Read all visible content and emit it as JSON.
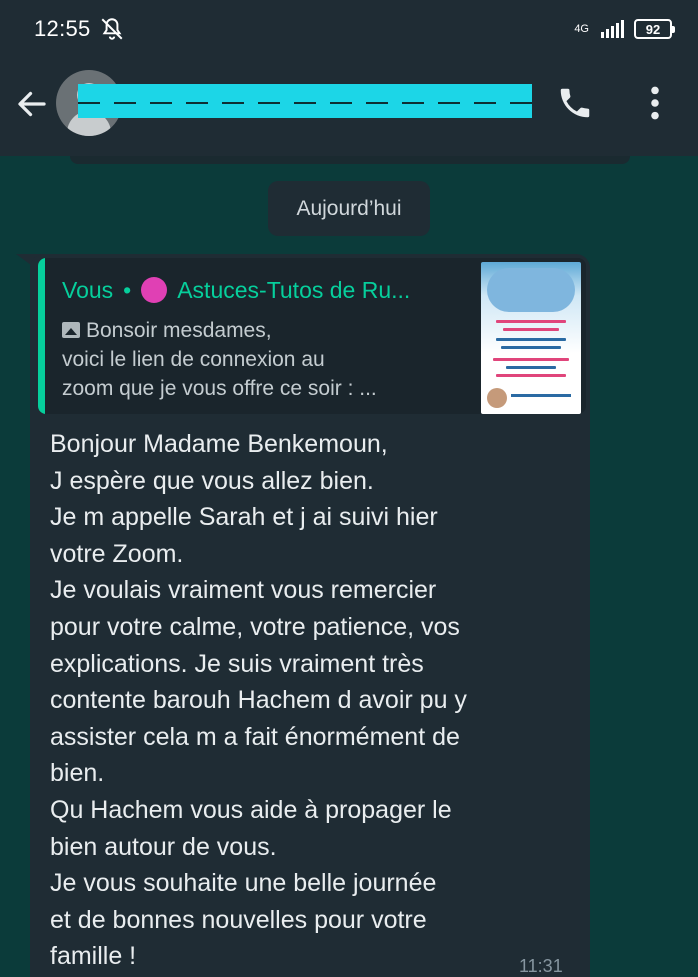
{
  "status_bar": {
    "time": "12:55",
    "network": "4G",
    "battery": "92",
    "icons": [
      "mute-icon",
      "signal-icon",
      "battery-icon"
    ]
  },
  "header": {
    "contact_name": "",
    "icons": [
      "back-arrow-icon",
      "avatar-icon",
      "phone-icon",
      "more-vert-icon"
    ]
  },
  "date_separator": "Aujourd’hui",
  "quoted_message": {
    "author": "Vous",
    "separator": "•",
    "group": "Astuces-Tutos de Ru...",
    "lines": [
      "Bonsoir mesdames,",
      "voici le lien de connexion au",
      "zoom que je vous offre ce soir : ..."
    ]
  },
  "message": {
    "lines": [
      "Bonjour Madame Benkemoun,",
      "J espère que vous allez bien.",
      "Je m appelle Sarah et j ai suivi hier",
      "votre Zoom.",
      "Je voulais vraiment vous remercier",
      "pour votre calme, votre patience, vos",
      "explications. Je suis vraiment très",
      "contente barouh Hachem d avoir pu y",
      "assister cela m a fait énormément de",
      "bien.",
      "Qu Hachem vous aide à propager le",
      "bien autour de vous.",
      "Je vous souhaite une belle journée",
      "et de bonnes nouvelles pour votre",
      "famille !"
    ],
    "time": "11:31"
  },
  "colors": {
    "chat_background": "#0b3b3a",
    "bar_background": "#1f2c34",
    "accent": "#06cf9c",
    "redaction": "#1cd6e7"
  }
}
